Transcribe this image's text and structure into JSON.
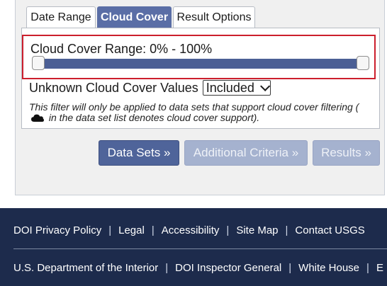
{
  "tabs": [
    {
      "label": "Date Range",
      "active": false
    },
    {
      "label": "Cloud Cover",
      "active": true
    },
    {
      "label": "Result Options",
      "active": false
    }
  ],
  "cloud_cover": {
    "range_label": "Cloud Cover Range: 0% - 100%",
    "range_min_percent": 0,
    "range_max_percent": 100
  },
  "unknown": {
    "label": "Unknown Cloud Cover Values",
    "selected": "Included"
  },
  "note": {
    "part1": "This filter will only be applied to data sets that support cloud cover filtering (",
    "part2": " in the data set list denotes cloud cover support).",
    "icon": "cloud-icon"
  },
  "buttons": {
    "data_sets": "Data Sets »",
    "additional_criteria": "Additional Criteria »",
    "results": "Results »"
  },
  "footer": {
    "row1": [
      "DOI Privacy Policy",
      "Legal",
      "Accessibility",
      "Site Map",
      "Contact USGS"
    ],
    "row2": [
      "U.S. Department of the Interior",
      "DOI Inspector General",
      "White House",
      "E"
    ],
    "separator": "|"
  },
  "colors": {
    "active_tab": "#5a6ea6",
    "slider": "#4b5f95",
    "highlight_border": "#cc1f2d",
    "footer_bg": "#1d2b4c"
  }
}
